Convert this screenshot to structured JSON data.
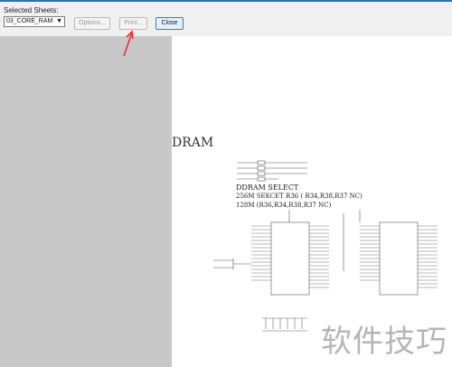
{
  "toolbar": {
    "label": "Selected Sheets:",
    "sheet_value": "03_CORE_RAM",
    "options_label": "Options...",
    "print_label": "Print...",
    "close_label": "Close"
  },
  "sheet": {
    "title": "DRAM",
    "select_heading": "DDRAM SELECT",
    "line1": "256M SEKCET R36 ( R34,R38,R37 NC)",
    "line2": "128M (R36,R34,R38,R37 NC)"
  },
  "watermark": "软件技巧",
  "colors": {
    "accent": "#2f6fbf",
    "annotation_arrow": "#e53030"
  }
}
